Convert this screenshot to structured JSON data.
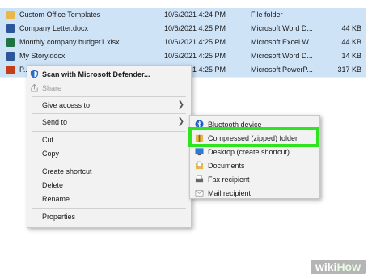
{
  "files": [
    {
      "name": "Custom Office Templates",
      "date": "10/6/2021 4:24 PM",
      "type": "File folder",
      "size": "",
      "icon": "folder-icon",
      "kind": "folder"
    },
    {
      "name": "Company Letter.docx",
      "date": "10/6/2021 4:25 PM",
      "type": "Microsoft Word D...",
      "size": "44 KB",
      "icon": "word-doc-icon",
      "kind": "word"
    },
    {
      "name": "Monthly company budget1.xlsx",
      "date": "10/6/2021 4:25 PM",
      "type": "Microsoft Excel W...",
      "size": "44 KB",
      "icon": "excel-doc-icon",
      "kind": "excel"
    },
    {
      "name": "My Story.docx",
      "date": "10/6/2021 4:25 PM",
      "type": "Microsoft Word D...",
      "size": "14 KB",
      "icon": "word-doc-icon",
      "kind": "word"
    },
    {
      "name": "P...",
      "date": "10/6/2021 4:25 PM",
      "type": "Microsoft PowerP...",
      "size": "317 KB",
      "icon": "ppt-doc-icon",
      "kind": "ppt"
    }
  ],
  "context_menu": {
    "scan": "Scan with Microsoft Defender...",
    "share": "Share",
    "give_access": "Give access to",
    "send_to": "Send to",
    "cut": "Cut",
    "copy": "Copy",
    "create_shortcut": "Create shortcut",
    "delete": "Delete",
    "rename": "Rename",
    "properties": "Properties"
  },
  "send_to_menu": {
    "bluetooth": "Bluetooth device",
    "compressed": "Compressed (zipped) folder",
    "desktop": "Desktop (create shortcut)",
    "documents": "Documents",
    "fax": "Fax recipient",
    "mail": "Mail recipient"
  },
  "watermark": {
    "wiki": "wiki",
    "how": "How"
  },
  "colors": {
    "highlight": "#2ee41f",
    "selection": "#cfe3f7",
    "menu_bg": "#f2f2f2"
  }
}
